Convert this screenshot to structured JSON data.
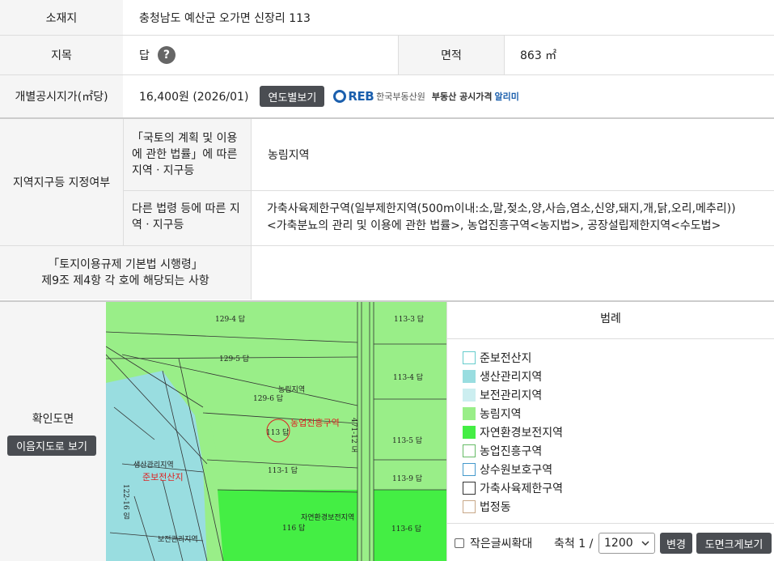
{
  "location": {
    "label": "소재지",
    "value": "충청남도 예산군 오가면 신장리 113"
  },
  "jimok": {
    "label": "지목",
    "value": "답"
  },
  "area": {
    "label": "면적",
    "value": "863 ㎡"
  },
  "price": {
    "label": "개별공시지가(㎡당)",
    "value": "16,400원 (2026/01)",
    "yearly_button": "연도별보기",
    "reb_logo": "REB",
    "reb_org": "한국부동산원",
    "reb_service": "부동산 공시가격",
    "reb_alimi": "알리미"
  },
  "zoning": {
    "label": "지역지구등 지정여부",
    "national_law_label": "「국토의 계획 및 이용에 관한 법률」에 따른 지역ㆍ지구등",
    "national_law_value": "농림지역",
    "other_law_label": "다른 법령 등에 따른 지역ㆍ지구등",
    "other_law_value_line1": "가축사육제한구역(일부제한지역(500m이내:소,말,젖소,양,사슴,염소,신양,돼지,개,닭,오리,메추리))",
    "other_law_value_line2": "<가축분뇨의 관리 및 이용에 관한 법률>, 농업진흥구역<농지법>, 공장설립제한지역<수도법>"
  },
  "land_use_act": {
    "label_line1": "「토지이용규제 기본법 시행령」",
    "label_line2": "제9조 제4항 각 호에 해당되는 사항",
    "value": ""
  },
  "map_section": {
    "label": "확인도면",
    "view_button": "이음지도로 보기"
  },
  "legend": {
    "title": "범례",
    "items": [
      {
        "label": "준보전산지",
        "fill": "#ffffff",
        "border": "#66cccc"
      },
      {
        "label": "생산관리지역",
        "fill": "#99dde0",
        "border": "#99dde0"
      },
      {
        "label": "보전관리지역",
        "fill": "#cceef0",
        "border": "#cceef0"
      },
      {
        "label": "농림지역",
        "fill": "#99ee88",
        "border": "#99ee88"
      },
      {
        "label": "자연환경보전지역",
        "fill": "#44ee44",
        "border": "#44ee44"
      },
      {
        "label": "농업진흥구역",
        "fill": "#ffffff",
        "border": "#66bb66"
      },
      {
        "label": "상수원보호구역",
        "fill": "#ffffff",
        "border": "#4499cc"
      },
      {
        "label": "가축사육제한구역",
        "fill": "#ffffff",
        "border": "#333333"
      },
      {
        "label": "법정동",
        "fill": "#ffffff",
        "border": "#c8a888"
      }
    ]
  },
  "map_controls": {
    "enlarge_text_label": "작은글씨확대",
    "scale_label": "축척 1 /",
    "scale_value": "1200",
    "change_button": "변경",
    "large_map_button": "도면크게보기"
  },
  "map_labels": {
    "p129_4": "129-4 답",
    "p113_3": "113-3 답",
    "p129_5": "129-5 답",
    "p113_4": "113-4 답",
    "nongrim": "농림지역",
    "p129_6": "129-6 답",
    "nongup": "농업진흥구역",
    "p113": "113 답",
    "p113_5": "113-5 답",
    "p113_1": "113-1 답",
    "p113_9": "113-9 답",
    "saengsan": "생산관리지역",
    "junbojeon": "준보전산지",
    "jayeon": "자연환경보전지역",
    "p116": "116 답",
    "p113_6": "113-6 답",
    "road_label": "471-12 도",
    "p122_16": "122-16 임",
    "bojeon": "보전관리지역"
  },
  "colors": {
    "header_bg": "#f5f5f5",
    "border": "#dddddd",
    "button_bg": "#4a4d52",
    "reb_blue": "#1b5fad",
    "nongrim_green": "#99ee88",
    "jayeon_green": "#44ee44",
    "saengsan_cyan": "#99dde0",
    "highlight_red": "#dd2222"
  }
}
